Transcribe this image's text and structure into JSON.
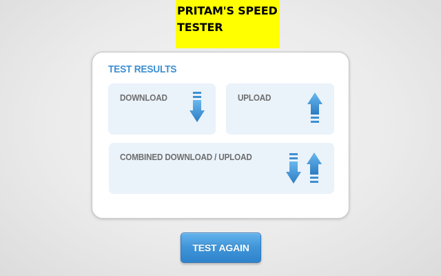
{
  "header": {
    "title_line1": "PRITAM'S SPEED",
    "title_line2": "TESTER"
  },
  "results": {
    "title": "TEST RESULTS",
    "panels": [
      {
        "label": "DOWNLOAD",
        "icon": "arrow-down-icon"
      },
      {
        "label": "UPLOAD",
        "icon": "arrow-up-icon"
      },
      {
        "label": "COMBINED DOWNLOAD / UPLOAD",
        "icon": "arrow-down-up-icon"
      }
    ]
  },
  "actions": {
    "test_again_label": "TEST AGAIN"
  },
  "colors": {
    "title_background": "#ffff00",
    "accent": "#3d8fd0",
    "panel_background": "#eaf2fa",
    "button": "#3f94d8"
  }
}
